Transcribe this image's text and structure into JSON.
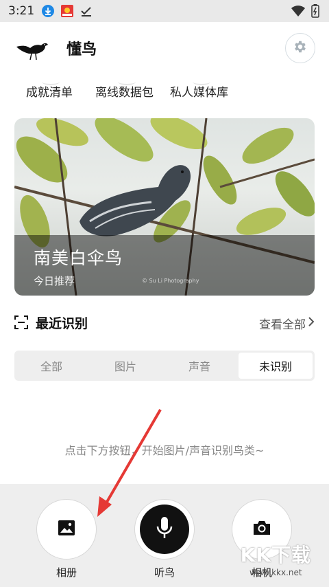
{
  "status_bar": {
    "time": "3:21"
  },
  "header": {
    "app_title": "懂鸟"
  },
  "quick_links": [
    {
      "label": "成就清单"
    },
    {
      "label": "离线数据包"
    },
    {
      "label": "私人媒体库"
    }
  ],
  "featured": {
    "bird_name": "南美白伞鸟",
    "subtitle": "今日推荐",
    "photo_credit": "© Su Li Photography"
  },
  "recent": {
    "title": "最近识别",
    "view_all": "查看全部",
    "tabs": [
      {
        "label": "全部",
        "active": false
      },
      {
        "label": "图片",
        "active": false
      },
      {
        "label": "声音",
        "active": false
      },
      {
        "label": "未识别",
        "active": true
      }
    ],
    "empty_hint": "点击下方按钮，开始图片/声音识别鸟类~"
  },
  "actions": [
    {
      "label": "相册",
      "icon": "image-icon"
    },
    {
      "label": "听鸟",
      "icon": "microphone-icon"
    },
    {
      "label": "相机",
      "icon": "camera-icon"
    }
  ],
  "watermark": {
    "text": "KK下载",
    "url": "www.kkx.net"
  },
  "colors": {
    "accent_dark": "#111111",
    "arrow": "#e53935",
    "tab_bg": "#eeeeee"
  }
}
